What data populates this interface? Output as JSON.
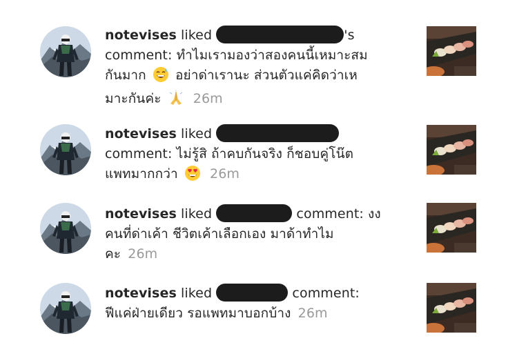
{
  "activity": [
    {
      "username": "notevises",
      "action": "liked",
      "possessive": "'s",
      "comment_prefix": "comment:",
      "line1_text": "ทำไมเรามองว่าสองคนนี้เหมาะสม",
      "line2a": "กันมาก",
      "emoji1": "grinning-sweat-emoji",
      "line2b": "อย่าด่าเรานะ ส่วนตัวแค่คิดว่าเห",
      "line3": "มาะกันค่ะ",
      "emoji2": "folded-hands-emoji",
      "time": "26m"
    },
    {
      "username": "notevises",
      "action": "liked",
      "comment_prefix": "comment:",
      "line2": "ไม่รู้สิ ถ้าคบกันจริง ก็ชอบคู่โน๊ต",
      "line3": "แพทมากกว่า",
      "emoji1": "heart-eyes-emoji",
      "time": "26m"
    },
    {
      "username": "notevises",
      "action": "liked",
      "comment_prefix": "comment:",
      "line1_text": "งง",
      "line2": "คนที่ด่าเค้า ชีวิตเค้าเลือกเอง มาด้าทำไม",
      "line3": "คะ",
      "time": "26m"
    },
    {
      "username": "notevises",
      "action": "liked",
      "comment_prefix": "comment:",
      "line2": "ฟีแค่ฝ่ายเดียว รอแพทมาบอกบ้าง",
      "time": "26m"
    }
  ],
  "icons": {
    "avatar": "mountaineer-avatar",
    "thumbnail": "sushi-post-thumbnail"
  },
  "colors": {
    "text": "#262626",
    "muted": "#999999",
    "redaction": "#1c1c1c"
  }
}
